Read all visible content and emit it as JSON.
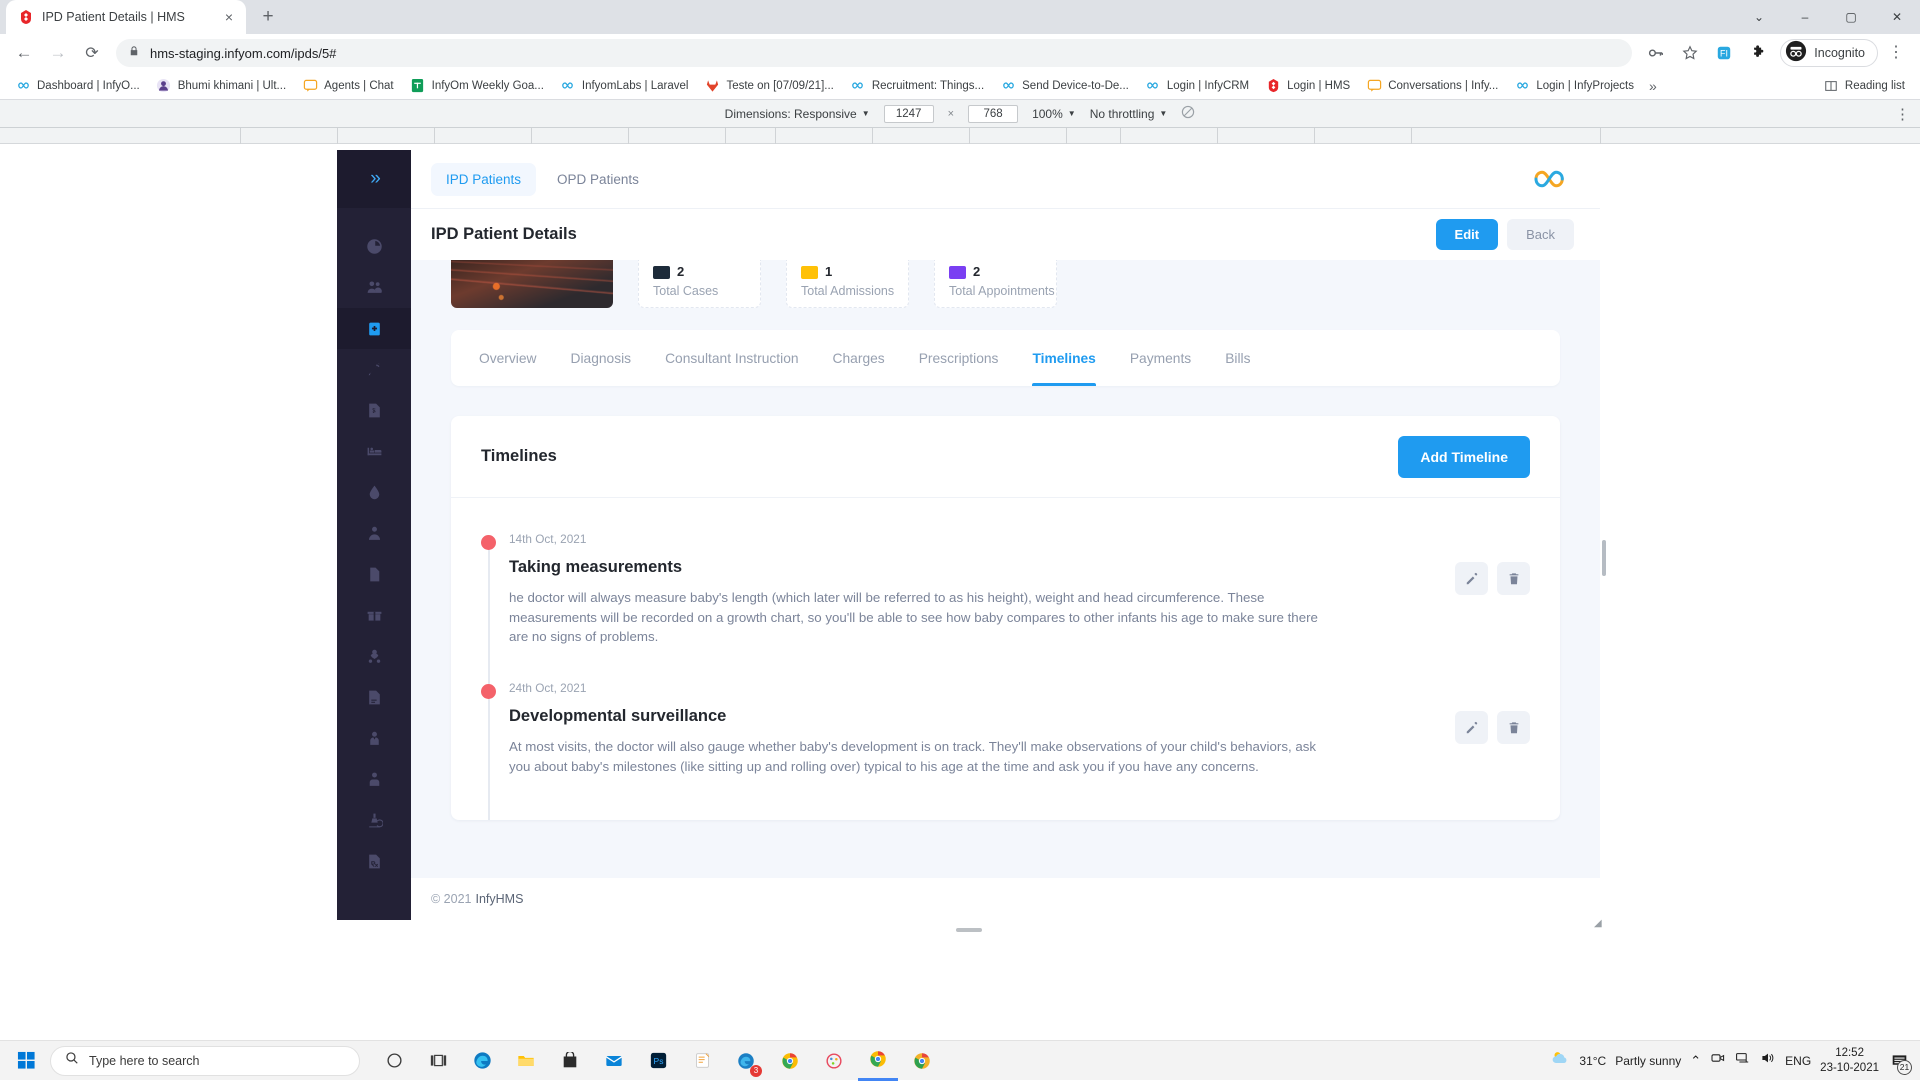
{
  "browser": {
    "tab": {
      "title": "IPD Patient Details | HMS",
      "favicon": "hms-logo-icon",
      "close": "×"
    },
    "new_tab": "+",
    "window_controls": {
      "minimize": "–",
      "maximize": "▢",
      "close": "✕",
      "more": "⌄"
    },
    "nav": {
      "back": "←",
      "forward": "→",
      "reload": "⟳"
    },
    "omnibox": {
      "url": "hms-staging.infyom.com/ipds/5#",
      "lock_icon": "lock-icon"
    },
    "toolbar_right": {
      "password_icon": "key-icon",
      "bookmark_icon": "star-icon",
      "extension_app_icon": "fi-extension-icon",
      "extensions_icon": "puzzle-piece-icon",
      "profile_label": "Incognito",
      "menu_icon": "three-dot-menu-icon"
    },
    "bookmarks": [
      {
        "label": "Dashboard | InfyO...",
        "icon": "infinity-icon"
      },
      {
        "label": "Bhumi khimani | Ult...",
        "icon": "avatar-icon"
      },
      {
        "label": "Agents | Chat",
        "icon": "chat-icon"
      },
      {
        "label": "InfyOm Weekly Goa...",
        "icon": "sheets-icon"
      },
      {
        "label": "InfyomLabs | Laravel",
        "icon": "infinity-icon"
      },
      {
        "label": "Teste on [07/09/21]...",
        "icon": "gitlab-icon"
      },
      {
        "label": "Recruitment: Things...",
        "icon": "infinity-icon"
      },
      {
        "label": "Send Device-to-De...",
        "icon": "infinity-icon"
      },
      {
        "label": "Login | InfyCRM",
        "icon": "infinity-icon"
      },
      {
        "label": "Login | HMS",
        "icon": "hms-logo-icon"
      },
      {
        "label": "Conversations | Infy...",
        "icon": "chat-icon"
      },
      {
        "label": "Login | InfyProjects",
        "icon": "infinity-icon"
      }
    ],
    "bookmarks_overflow": "»",
    "reading_list": {
      "label": "Reading list",
      "icon": "reading-list-icon"
    }
  },
  "devtools_device_bar": {
    "dimensions_label": "Dimensions: Responsive",
    "width": "1247",
    "height": "768",
    "separator": "×",
    "zoom": "100%",
    "throttling": "No throttling",
    "rotate_icon": "rotate-disabled-icon",
    "caret": "▼",
    "menu_icon": "vertical-dots-icon"
  },
  "app": {
    "sidebar": {
      "collapse_icon": "chevrons-right-icon",
      "items": [
        {
          "name": "dashboard",
          "icon": "pie-chart-icon",
          "active": false
        },
        {
          "name": "users",
          "icon": "users-icon",
          "active": false
        },
        {
          "name": "patients",
          "icon": "clipboard-medical-icon",
          "active": true
        },
        {
          "name": "vaccinations",
          "icon": "syringe-icon",
          "active": false
        },
        {
          "name": "invoices",
          "icon": "file-invoice-icon",
          "active": false
        },
        {
          "name": "beds",
          "icon": "bed-icon",
          "active": false
        },
        {
          "name": "blood-bank",
          "icon": "blood-drop-icon",
          "active": false
        },
        {
          "name": "nurses",
          "icon": "user-nurse-icon",
          "active": false
        },
        {
          "name": "documents",
          "icon": "file-icon",
          "active": false
        },
        {
          "name": "inventory",
          "icon": "box-open-icon",
          "active": false
        },
        {
          "name": "doctors",
          "icon": "user-doctor-icon",
          "active": false
        },
        {
          "name": "reports",
          "icon": "file-report-icon",
          "active": false
        },
        {
          "name": "staff",
          "icon": "user-tie-icon",
          "active": false
        },
        {
          "name": "accountants",
          "icon": "user-account-icon",
          "active": false
        },
        {
          "name": "pathology",
          "icon": "microscope-icon",
          "active": false
        },
        {
          "name": "prescriptions",
          "icon": "prescription-icon",
          "active": false
        }
      ]
    },
    "topnav": {
      "tabs": [
        {
          "label": "IPD Patients",
          "active": true
        },
        {
          "label": "OPD Patients",
          "active": false
        }
      ],
      "logo": "infinity-brand-logo"
    },
    "page": {
      "title": "IPD Patient Details",
      "edit_label": "Edit",
      "back_label": "Back"
    },
    "stats": [
      {
        "label": "Total Cases",
        "value": "2",
        "icon": "case-icon",
        "color": "#1d2b3a"
      },
      {
        "label": "Total Admissions",
        "value": "1",
        "icon": "calendar-icon",
        "color": "#ffc107"
      },
      {
        "label": "Total Appointments",
        "value": "2",
        "icon": "check-square-icon",
        "color": "#7a3ff2"
      }
    ],
    "detail_tabs": [
      {
        "label": "Overview",
        "active": false
      },
      {
        "label": "Diagnosis",
        "active": false
      },
      {
        "label": "Consultant Instruction",
        "active": false
      },
      {
        "label": "Charges",
        "active": false
      },
      {
        "label": "Prescriptions",
        "active": false
      },
      {
        "label": "Timelines",
        "active": true
      },
      {
        "label": "Payments",
        "active": false
      },
      {
        "label": "Bills",
        "active": false
      }
    ],
    "timelines": {
      "card_title": "Timelines",
      "add_button": "Add Timeline",
      "entries": [
        {
          "date": "14th Oct, 2021",
          "title": "Taking measurements",
          "description": "he doctor will always measure baby's length (which later will be referred to as his height), weight and head circumference. These measurements will be recorded on a growth chart, so you'll be able to see how baby compares to other infants his age to make sure there are no signs of problems.",
          "edit_icon": "pencil-icon",
          "delete_icon": "trash-icon"
        },
        {
          "date": "24th Oct, 2021",
          "title": "Developmental surveillance",
          "description": "At most visits, the doctor will also gauge whether baby's development is on track. They'll make observations of your child's behaviors, ask you about baby's milestones (like sitting up and rolling over) typical to his age at the time and ask you if you have any concerns.",
          "edit_icon": "pencil-icon",
          "delete_icon": "trash-icon"
        }
      ]
    },
    "footer": {
      "copyright": "© 2021",
      "brand": "InfyHMS"
    }
  },
  "taskbar": {
    "start_icon": "windows-start-icon",
    "search_placeholder": "Type here to search",
    "search_icon": "search-icon",
    "apps": [
      {
        "name": "cortana-icon"
      },
      {
        "name": "task-view-icon"
      },
      {
        "name": "edge-icon"
      },
      {
        "name": "file-explorer-icon"
      },
      {
        "name": "store-icon"
      },
      {
        "name": "mail-icon"
      },
      {
        "name": "photoshop-icon"
      },
      {
        "name": "notepad-icon"
      },
      {
        "name": "edge-dev-icon"
      },
      {
        "name": "chrome-icon"
      },
      {
        "name": "paint-icon"
      },
      {
        "name": "chrome-active-icon"
      },
      {
        "name": "chrome-beta-icon"
      }
    ],
    "tray": {
      "weather_icon": "partly-sunny-icon",
      "temperature": "31°C",
      "condition": "Partly sunny",
      "chevron": "⌃",
      "camera_icon": "camera-icon",
      "network_icon": "network-icon",
      "volume_icon": "volume-icon",
      "language": "ENG",
      "time": "12:52",
      "date": "23-10-2021",
      "notification_icon": "notification-icon",
      "notification_count": "21"
    }
  }
}
